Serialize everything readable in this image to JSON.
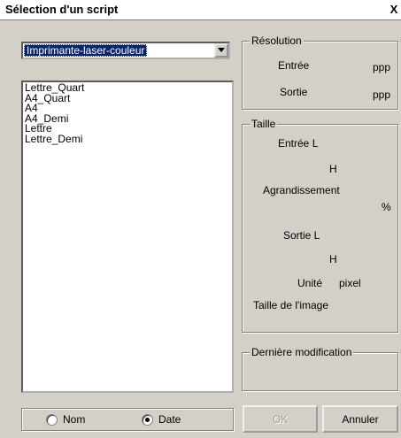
{
  "window": {
    "title": "Sélection d'un script",
    "close_label": "X"
  },
  "script_select": {
    "value": "Imprimante-laser-couleur"
  },
  "script_list": {
    "items": [
      "Lettre_Quart",
      "A4_Quart",
      "A4",
      "A4_Demi",
      "Lettre",
      "Lettre_Demi"
    ]
  },
  "sort": {
    "options": [
      {
        "label": "Nom",
        "selected": false
      },
      {
        "label": "Date",
        "selected": true
      }
    ]
  },
  "resolution": {
    "title": "Résolution",
    "entree_label": "Entrée",
    "entree_unit": "ppp",
    "sortie_label": "Sortie",
    "sortie_unit": "ppp"
  },
  "taille": {
    "title": "Taille",
    "entree_l_label": "Entrée L",
    "h1_label": "H",
    "agrandissement_label": "Agrandissement",
    "pct_label": "%",
    "sortie_l_label": "Sortie L",
    "h2_label": "H",
    "unite_label": "Unité",
    "unite_value": "pixel",
    "taille_image_label": "Taille de l'image"
  },
  "derniere": {
    "title": "Dernière modification"
  },
  "buttons": {
    "ok": "OK",
    "annuler": "Annuler"
  }
}
